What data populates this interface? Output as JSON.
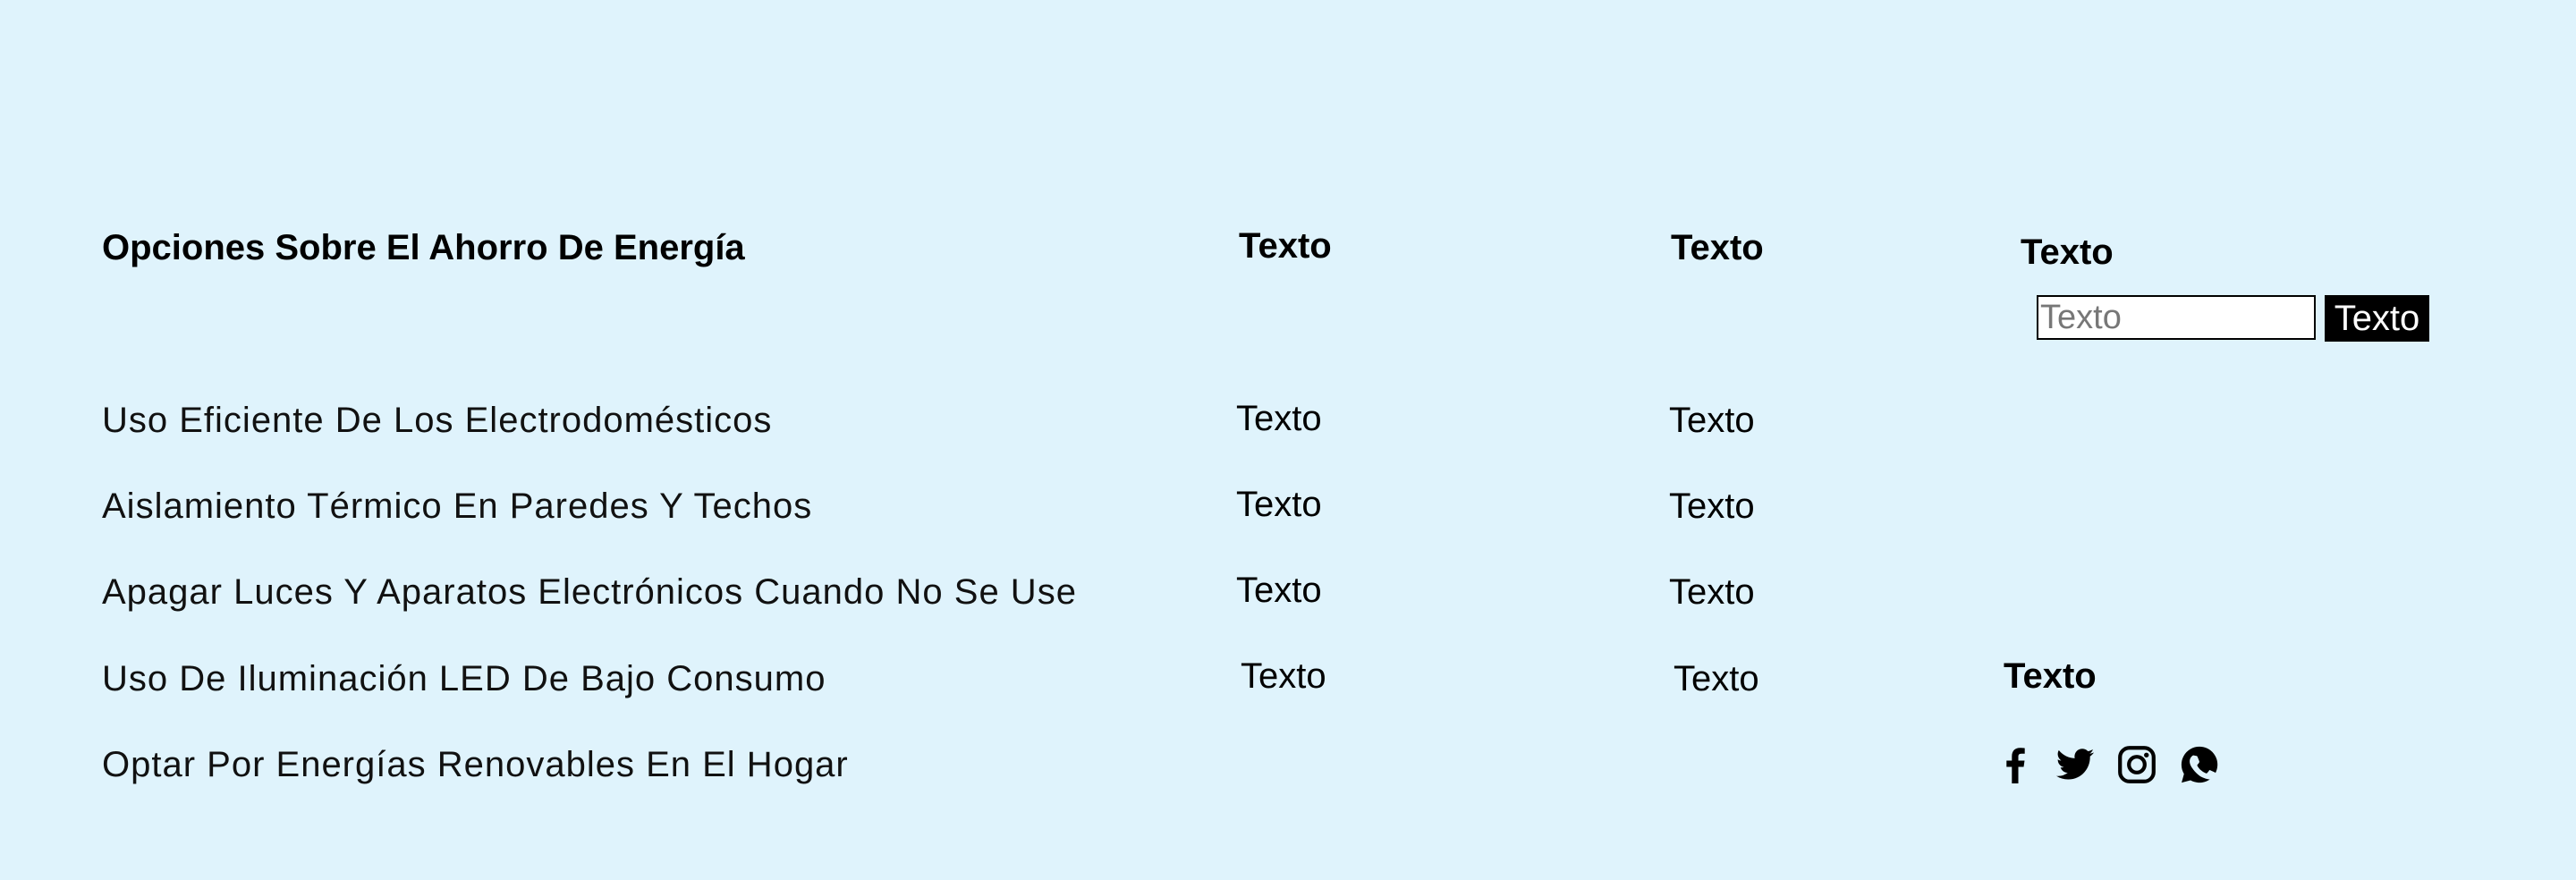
{
  "footer": {
    "heading": "Opciones Sobre El Ahorro De Energía",
    "items": [
      "Uso Eficiente De Los Electrodomésticos",
      "Aislamiento Térmico En Paredes Y Techos",
      "Apagar Luces Y Aparatos Electrónicos Cuando No Se Use",
      "Uso De Iluminación LED De Bajo Consumo",
      "Optar Por Energías Renovables En El Hogar"
    ],
    "column2": {
      "title": "Texto",
      "links": [
        "Texto",
        "Texto",
        "Texto",
        "Texto"
      ]
    },
    "column3": {
      "title": "Texto",
      "links": [
        "Texto",
        "Texto",
        "Texto",
        "Texto"
      ]
    },
    "newsletter": {
      "title": "Texto",
      "input_placeholder": "Texto",
      "button_label": "Texto"
    },
    "social": {
      "title": "Texto",
      "icons": [
        "facebook-icon",
        "twitter-icon",
        "instagram-icon",
        "whatsapp-icon"
      ]
    }
  },
  "colors": {
    "background": "#dff3fc",
    "text": "#000000",
    "button_bg": "#000000",
    "button_text": "#ffffff"
  }
}
